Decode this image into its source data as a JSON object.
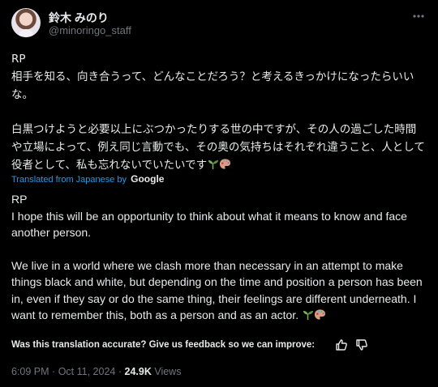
{
  "author": {
    "display_name": "鈴木 みのり",
    "handle": "@minoringo_staff"
  },
  "icons": {
    "more": "more-horizontal-icon",
    "avatar": "avatar-image",
    "seedling": "seedling-emoji",
    "palette": "artist-palette-emoji",
    "thumbs_up": "thumbs-up-icon",
    "thumbs_down": "thumbs-down-icon"
  },
  "original_text": {
    "line1": "RP",
    "line2": "相手を知る、向き合うって、どんなことだろう？と考えるきっかけになったらいいな。",
    "line3": "白黒つけようと必要以上にぶつかったりする世の中ですが、その人の過ごした時間や立場によって、例え同じ言動でも、その奥の気持ちはそれぞれ違うこと、人として役者として、私も忘れないでいたいです"
  },
  "translation_notice": {
    "prefix": "Translated from Japanese by",
    "provider": "Google"
  },
  "translated_text": {
    "line1": "RP",
    "line2": "I hope this will be an opportunity to think about what it means to know and face another person.",
    "line3": "We live in a world where we clash more than necessary in an attempt to make things black and white, but depending on the time and position a person has been in, even if they say or do the same thing, their feelings are different underneath. I want to remember this, both as a person and as an actor."
  },
  "feedback": {
    "prompt": "Was this translation accurate? Give us feedback so we can improve:"
  },
  "meta": {
    "time": "6:09 PM",
    "separator": "·",
    "date": "Oct 11, 2024",
    "views_count": "24.9K",
    "views_label": "Views"
  },
  "colors": {
    "background": "#000000",
    "text": "#e7e9ea",
    "secondary": "#71767b",
    "link": "#1d9bf0"
  }
}
